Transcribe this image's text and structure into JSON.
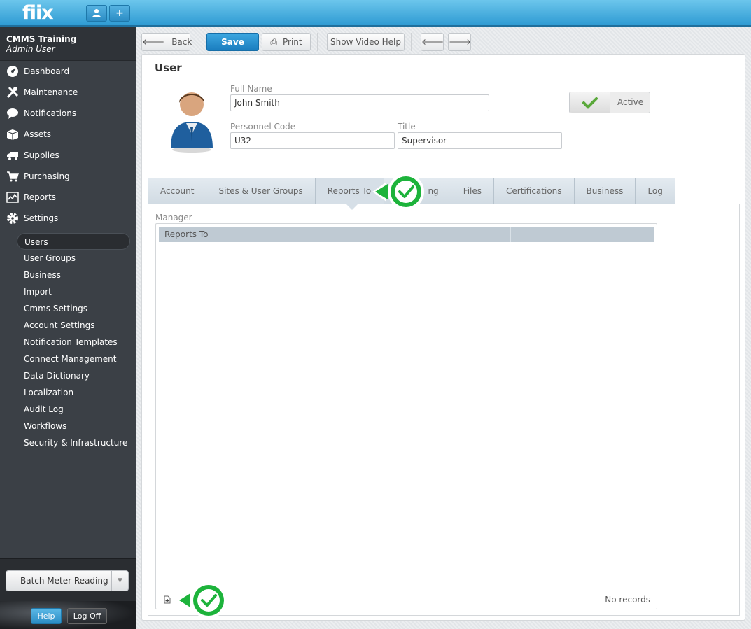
{
  "app": {
    "logo": "fiix",
    "user_icon": "user-icon",
    "add_symbol": "+"
  },
  "sidebar": {
    "org_name": "CMMS Training",
    "user_name": "Admin User",
    "nav": [
      {
        "label": "Dashboard",
        "icon": "dashboard-icon"
      },
      {
        "label": "Maintenance",
        "icon": "tools-icon"
      },
      {
        "label": "Notifications",
        "icon": "chat-bubble-icon"
      },
      {
        "label": "Assets",
        "icon": "box-icon"
      },
      {
        "label": "Supplies",
        "icon": "truck-icon"
      },
      {
        "label": "Purchasing",
        "icon": "cart-icon"
      },
      {
        "label": "Reports",
        "icon": "chart-icon"
      },
      {
        "label": "Settings",
        "icon": "gear-icon"
      }
    ],
    "settings_items": [
      "Users",
      "User Groups",
      "Business",
      "Import",
      "Cmms Settings",
      "Account Settings",
      "Notification Templates",
      "Connect Management",
      "Data Dictionary",
      "Localization",
      "Audit Log",
      "Workflows",
      "Security & Infrastructure"
    ],
    "batch_label": "Batch Meter Reading",
    "help_label": "Help",
    "logoff_label": "Log Off"
  },
  "toolbar": {
    "back_label": "Back",
    "save_label": "Save",
    "print_label": "Print",
    "video_label": "Show Video Help"
  },
  "user": {
    "title": "User",
    "full_name_label": "Full Name",
    "full_name": "John Smith",
    "personnel_code_label": "Personnel Code",
    "personnel_code": "U32",
    "title_label": "Title",
    "job_title": "Supervisor",
    "active_label": "Active"
  },
  "tabs": [
    "Account",
    "Sites & User Groups",
    "Reports To",
    "ng",
    "Files",
    "Certifications",
    "Business",
    "Log"
  ],
  "reports_to": {
    "section_label": "Manager",
    "column_header": "Reports To",
    "empty_text": "No records"
  },
  "colors": {
    "accent": "#2f9bd3",
    "callout_green": "#1db33b",
    "sidebar": "#3b4046"
  }
}
